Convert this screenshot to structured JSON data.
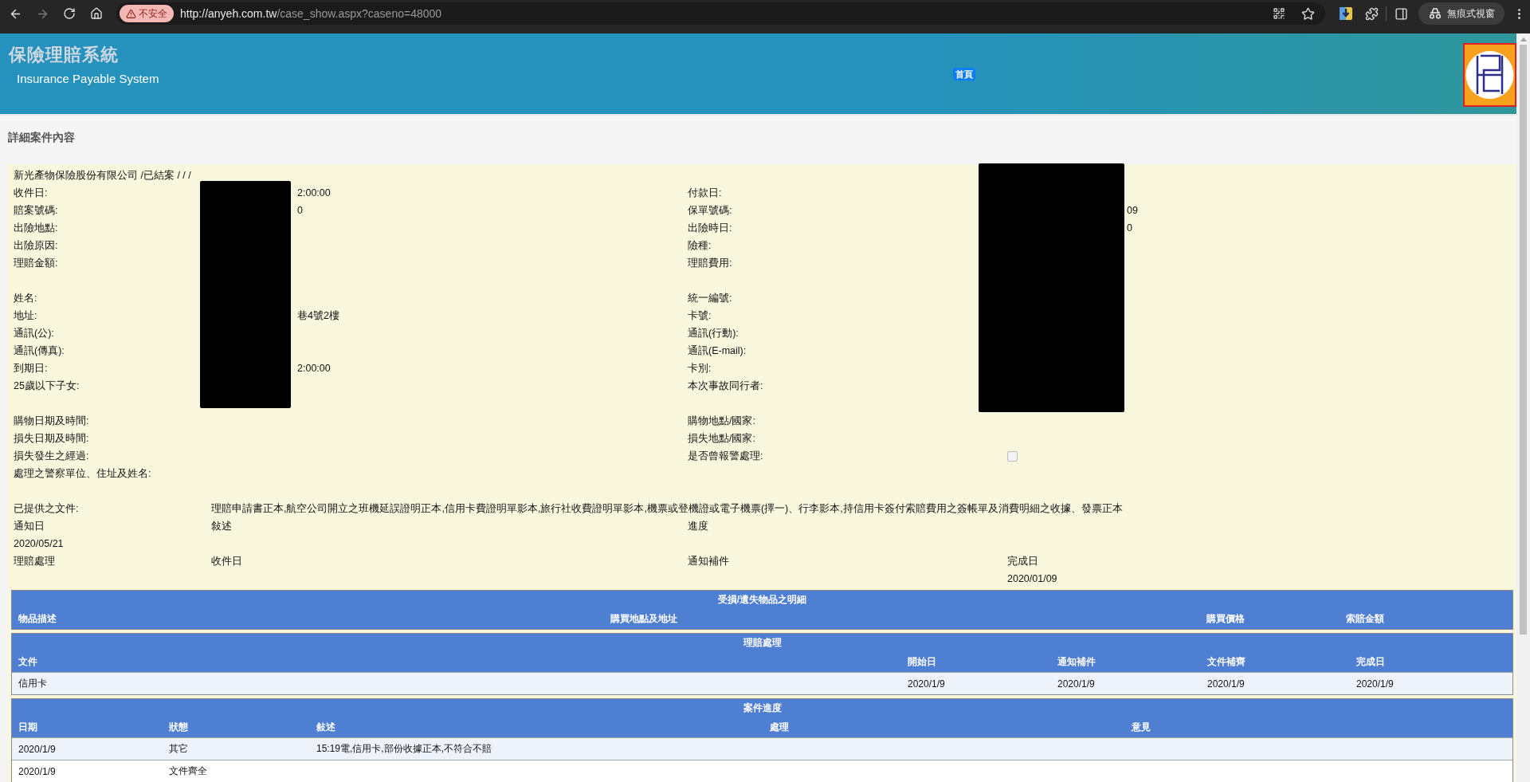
{
  "browser": {
    "security_label": "不安全",
    "url_host": "http://anyeh.com.tw",
    "url_path": "/case_show.aspx?caseno=48000",
    "profile_label": "無痕式視窗"
  },
  "header": {
    "title": "保險理賠系統",
    "subtitle": "Insurance Payable System",
    "home_link": "首頁"
  },
  "page_title": "詳細案件內容",
  "summary": "新光產物保險股份有限公司 /已結案 / / /",
  "fields": [
    {
      "kind": "pair",
      "left": {
        "label": "收件日:",
        "value": "2:00:00"
      },
      "right": {
        "label": "付款日:"
      }
    },
    {
      "kind": "pair",
      "left": {
        "label": "賠案號碼:",
        "value": "0"
      },
      "right": {
        "label": "保單號碼:",
        "value": "09"
      }
    },
    {
      "kind": "pair",
      "left": {
        "label": "出險地點:"
      },
      "right": {
        "label": "出險時日:",
        "value": "0"
      }
    },
    {
      "kind": "pair",
      "left": {
        "label": "出險原因:"
      },
      "right": {
        "label": "險種:"
      }
    },
    {
      "kind": "pair",
      "left": {
        "label": "理賠金額:"
      },
      "right": {
        "label": "理賠費用:"
      }
    },
    {
      "kind": "spacer"
    },
    {
      "kind": "pair",
      "left": {
        "label": "姓名:"
      },
      "right": {
        "label": "統一編號:"
      }
    },
    {
      "kind": "pair",
      "left": {
        "label": "地址:",
        "value": "巷4號2樓"
      },
      "right": {
        "label": "卡號:"
      }
    },
    {
      "kind": "pair",
      "left": {
        "label": "通訊(公):"
      },
      "right": {
        "label": "通訊(行動):"
      }
    },
    {
      "kind": "pair",
      "left": {
        "label": "通訊(傳真):"
      },
      "right": {
        "label": "通訊(E-mail):"
      }
    },
    {
      "kind": "pair",
      "left": {
        "label": "到期日:",
        "value": "2:00:00"
      },
      "right": {
        "label": "卡別:"
      }
    },
    {
      "kind": "pair",
      "left": {
        "label": "25歲以下子女:"
      },
      "right": {
        "label": "本次事故同行者:"
      }
    },
    {
      "kind": "spacer"
    },
    {
      "kind": "pair",
      "left": {
        "label": "購物日期及時間:"
      },
      "right": {
        "label": "購物地點/國家:"
      }
    },
    {
      "kind": "pair",
      "left": {
        "label": "損失日期及時間:"
      },
      "right": {
        "label": "損失地點/國家:"
      }
    },
    {
      "kind": "pair",
      "left": {
        "label": "損失發生之經過:"
      },
      "right": {
        "label": "是否曾報警處理:",
        "checkbox": {
          "checked": false
        }
      }
    },
    {
      "kind": "pair",
      "left": {
        "label": "處理之警察單位、住址及姓名:"
      }
    },
    {
      "kind": "spacer"
    }
  ],
  "documents": {
    "label": "已提供之文件:",
    "value": "理賠申請書正本,航空公司開立之班機延誤證明正本,信用卡費證明單影本,旅行社收費證明單影本,機票或登機證或電子機票(擇一)、行李影本,持信用卡簽付索賠費用之簽帳單及消費明細之收據、發票正本"
  },
  "progress_grid": [
    {
      "column_1": "通知日",
      "column_2": "敍述",
      "column_3": "進度"
    },
    {
      "column_1": "2020/05/21"
    },
    {
      "column_1": "理賠處理",
      "column_2": "收件日",
      "column_3": "通知補件",
      "column_4": "完成日"
    },
    {
      "column_4": "2020/01/09"
    }
  ],
  "tables": [
    {
      "title": "受損/遺失物品之明細",
      "columns": [
        "物品描述",
        "購買地點及地址",
        "購買價格",
        "索賠金額"
      ]
    },
    {
      "title": "理賠處理",
      "columns": [
        "文件",
        "開始日",
        "通知補件",
        "文件補齊",
        "完成日"
      ],
      "rows": [
        [
          "信用卡",
          "2020/1/9",
          "2020/1/9",
          "2020/1/9",
          "2020/1/9"
        ]
      ]
    },
    {
      "title": "案件進度",
      "columns": [
        "日期",
        "狀態",
        "敍述",
        "處理",
        "意見"
      ],
      "rows": [
        [
          "2020/1/9",
          "其它",
          "15:19電,信用卡,部份收據正本,不符合不賠"
        ],
        [
          "2020/1/9",
          "文件齊全"
        ]
      ]
    }
  ]
}
